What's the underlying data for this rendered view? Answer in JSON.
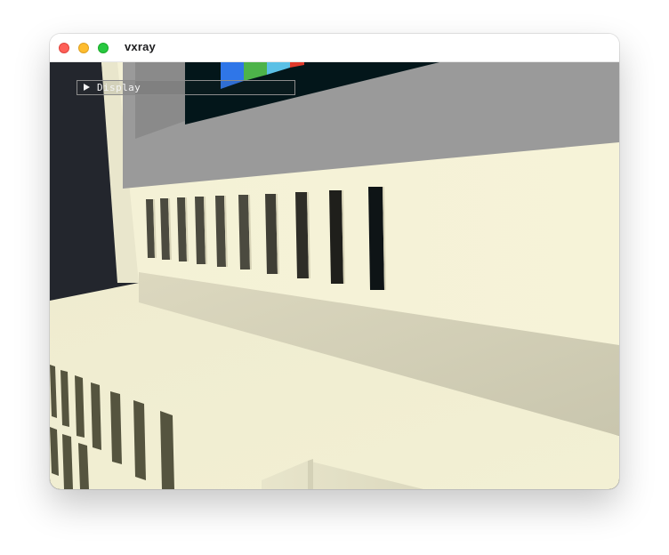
{
  "window": {
    "title": "vxray"
  },
  "traffic_lights": {
    "close": "close-button",
    "minimize": "minimize-button",
    "maximize": "zoom-button"
  },
  "display_panel": {
    "label": "Display",
    "expanded": false,
    "toggle_icon": "triangle-right-icon"
  },
  "scene": {
    "description_colors": {
      "background": "#23262d",
      "casing": "#f3f0d4",
      "screen_bezel": "#9a9a9a",
      "screen": "#03161a",
      "color_bar_blue": "#2f76e8",
      "color_bar_green": "#4db34a",
      "color_bar_cyan": "#5bc0e6",
      "color_bar_red": "#e23a2c"
    }
  }
}
